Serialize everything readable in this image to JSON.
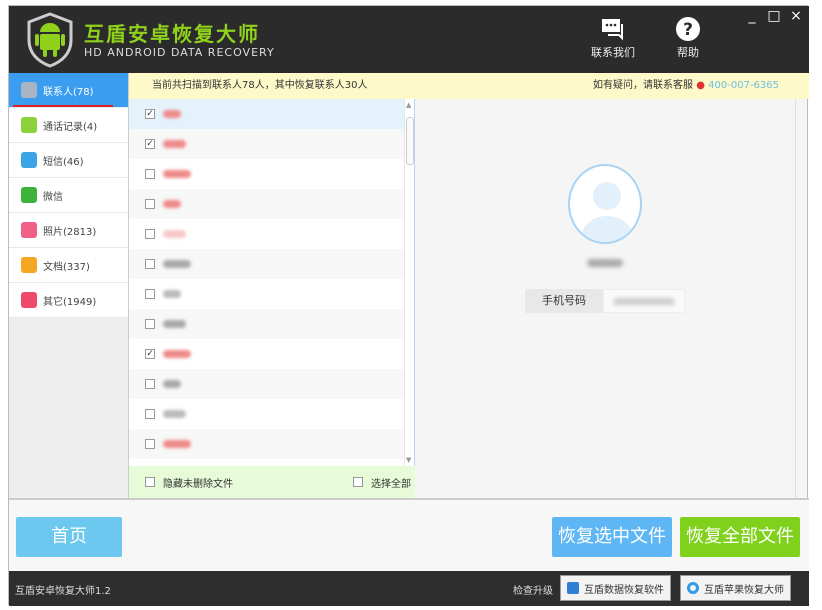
{
  "app": {
    "title": "互盾安卓恢复大师",
    "subtitle": "HD ANDROID DATA RECOVERY"
  },
  "header": {
    "contact_label": "联系我们",
    "help_label": "帮助",
    "minimize": "_",
    "maximize": "□",
    "close": "×"
  },
  "notice": {
    "left": "当前共扫描到联系人78人，其中恢复联系人30人",
    "right": "如有疑问，请联系客服",
    "phone": "400-007-6365"
  },
  "sidebar": {
    "items": [
      {
        "label": "联系人(78)",
        "icon": "contacts-icon",
        "color": "#a8b4c4",
        "active": true
      },
      {
        "label": "通话记录(4)",
        "icon": "phone-icon",
        "color": "#8bd13a"
      },
      {
        "label": "短信(46)",
        "icon": "sms-icon",
        "color": "#3aa6e8"
      },
      {
        "label": "微信",
        "icon": "wechat-icon",
        "color": "#3bb33b"
      },
      {
        "label": "照片(2813)",
        "icon": "photo-icon",
        "color": "#ef5f86"
      },
      {
        "label": "文档(337)",
        "icon": "document-icon",
        "color": "#f5a623"
      },
      {
        "label": "其它(1949)",
        "icon": "other-icon",
        "color": "#f04a6a"
      }
    ]
  },
  "list": {
    "rows": [
      {
        "checked": true,
        "name_color": "#f08a8a"
      },
      {
        "checked": true,
        "name_color": "#f08a8a"
      },
      {
        "checked": false,
        "name_color": "#f08a8a"
      },
      {
        "checked": false,
        "name_color": "#f08a8a"
      },
      {
        "checked": false,
        "name_color": "#f8c8c8"
      },
      {
        "checked": false,
        "name_color": "#aaaaaa"
      },
      {
        "checked": false,
        "name_color": "#bbbbbb"
      },
      {
        "checked": false,
        "name_color": "#aaaaaa"
      },
      {
        "checked": true,
        "name_color": "#f08a8a"
      },
      {
        "checked": false,
        "name_color": "#aaaaaa"
      },
      {
        "checked": false,
        "name_color": "#bbbbbb"
      },
      {
        "checked": false,
        "name_color": "#f08a8a"
      }
    ],
    "hide_undeleted": "隐藏未删除文件",
    "select_all": "选择全部"
  },
  "detail": {
    "phone_label": "手机号码"
  },
  "buttons": {
    "home": "首页",
    "recover_selected": "恢复选中文件",
    "recover_all": "恢复全部文件"
  },
  "footer": {
    "version": "互盾安卓恢复大师1.2",
    "check_update": "检查升级",
    "product1": "互盾数据恢复软件",
    "product2": "互盾苹果恢复大师"
  },
  "colors": {
    "accent": "#3b9df0",
    "green": "#8fd11b"
  }
}
